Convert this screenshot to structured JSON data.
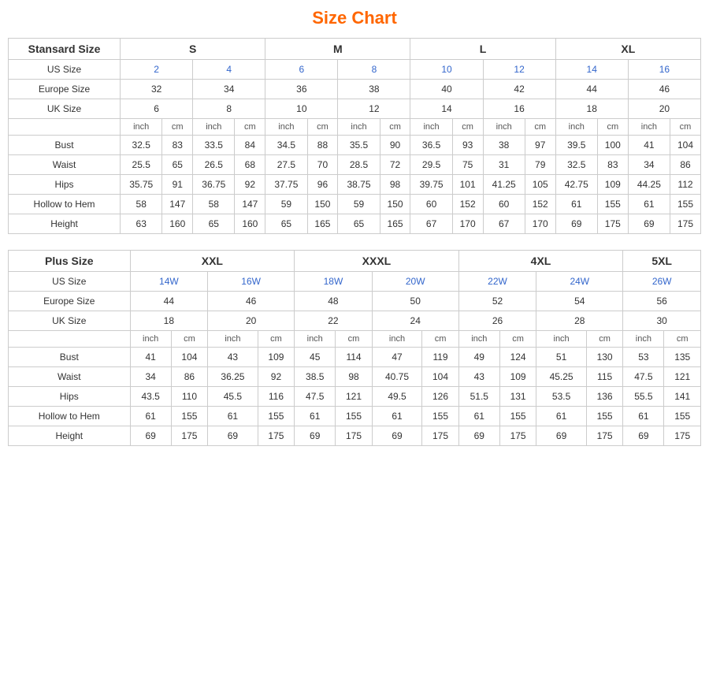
{
  "title": "Size Chart",
  "standard": {
    "sections": [
      {
        "groupLabel": "Stansard Size",
        "sizeHeaders": [
          "S",
          "M",
          "L",
          "XL"
        ],
        "sizeSpans": [
          2,
          2,
          2,
          2
        ],
        "usSize": {
          "label": "US Size",
          "values": [
            "2",
            "4",
            "6",
            "8",
            "10",
            "12",
            "14",
            "16"
          ]
        },
        "europeSize": {
          "label": "Europe Size",
          "values": [
            "32",
            "34",
            "36",
            "38",
            "40",
            "42",
            "44",
            "46"
          ]
        },
        "ukSize": {
          "label": "UK Size",
          "values": [
            "6",
            "8",
            "10",
            "12",
            "14",
            "16",
            "18",
            "20"
          ]
        },
        "unitRow": [
          "inch",
          "cm",
          "inch",
          "cm",
          "inch",
          "cm",
          "inch",
          "cm",
          "inch",
          "cm",
          "inch",
          "cm",
          "inch",
          "cm",
          "inch",
          "cm"
        ],
        "measurements": [
          {
            "label": "Bust",
            "values": [
              "32.5",
              "83",
              "33.5",
              "84",
              "34.5",
              "88",
              "35.5",
              "90",
              "36.5",
              "93",
              "38",
              "97",
              "39.5",
              "100",
              "41",
              "104"
            ]
          },
          {
            "label": "Waist",
            "values": [
              "25.5",
              "65",
              "26.5",
              "68",
              "27.5",
              "70",
              "28.5",
              "72",
              "29.5",
              "75",
              "31",
              "79",
              "32.5",
              "83",
              "34",
              "86"
            ]
          },
          {
            "label": "Hips",
            "values": [
              "35.75",
              "91",
              "36.75",
              "92",
              "37.75",
              "96",
              "38.75",
              "98",
              "39.75",
              "101",
              "41.25",
              "105",
              "42.75",
              "109",
              "44.25",
              "112"
            ]
          },
          {
            "label": "Hollow to Hem",
            "values": [
              "58",
              "147",
              "58",
              "147",
              "59",
              "150",
              "59",
              "150",
              "60",
              "152",
              "60",
              "152",
              "61",
              "155",
              "61",
              "155"
            ]
          },
          {
            "label": "Height",
            "values": [
              "63",
              "160",
              "65",
              "160",
              "65",
              "165",
              "65",
              "165",
              "67",
              "170",
              "67",
              "170",
              "69",
              "175",
              "69",
              "175"
            ]
          }
        ]
      }
    ]
  },
  "plus": {
    "sections": [
      {
        "groupLabel": "Plus Size",
        "sizeHeaders": [
          "XXL",
          "XXXL",
          "4XL",
          "5XL"
        ],
        "sizeSpans": [
          2,
          2,
          2,
          1
        ],
        "usSize": {
          "label": "US Size",
          "values": [
            "14W",
            "16W",
            "18W",
            "20W",
            "22W",
            "24W",
            "26W"
          ]
        },
        "europeSize": {
          "label": "Europe Size",
          "values": [
            "44",
            "46",
            "48",
            "50",
            "52",
            "54",
            "56"
          ]
        },
        "ukSize": {
          "label": "UK Size",
          "values": [
            "18",
            "20",
            "22",
            "24",
            "26",
            "28",
            "30"
          ]
        },
        "unitRow": [
          "inch",
          "cm",
          "inch",
          "cm",
          "inch",
          "cm",
          "inch",
          "cm",
          "inch",
          "cm",
          "inch",
          "cm",
          "inch",
          "cm"
        ],
        "measurements": [
          {
            "label": "Bust",
            "values": [
              "41",
              "104",
              "43",
              "109",
              "45",
              "114",
              "47",
              "119",
              "49",
              "124",
              "51",
              "130",
              "53",
              "135"
            ]
          },
          {
            "label": "Waist",
            "values": [
              "34",
              "86",
              "36.25",
              "92",
              "38.5",
              "98",
              "40.75",
              "104",
              "43",
              "109",
              "45.25",
              "115",
              "47.5",
              "121"
            ]
          },
          {
            "label": "Hips",
            "values": [
              "43.5",
              "110",
              "45.5",
              "116",
              "47.5",
              "121",
              "49.5",
              "126",
              "51.5",
              "131",
              "53.5",
              "136",
              "55.5",
              "141"
            ]
          },
          {
            "label": "Hollow to Hem",
            "values": [
              "61",
              "155",
              "61",
              "155",
              "61",
              "155",
              "61",
              "155",
              "61",
              "155",
              "61",
              "155",
              "61",
              "155"
            ]
          },
          {
            "label": "Height",
            "values": [
              "69",
              "175",
              "69",
              "175",
              "69",
              "175",
              "69",
              "175",
              "69",
              "175",
              "69",
              "175",
              "69",
              "175"
            ]
          }
        ]
      }
    ]
  }
}
